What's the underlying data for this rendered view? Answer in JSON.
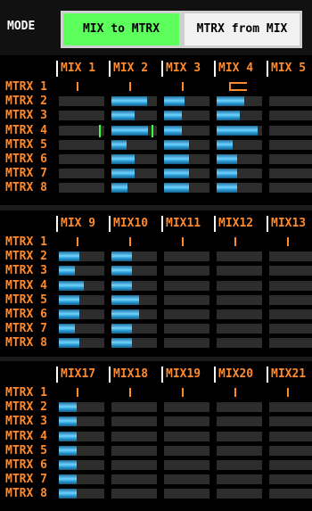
{
  "header": {
    "mode_label": "MODE",
    "mix_to_matrix_label": "MIX to MTRX",
    "matrix_from_mix_label": "MTRX from MIX",
    "active_mode": "MIX to MTRX"
  },
  "colors": {
    "accent_orange": "#ff8a2c",
    "active_green": "#5cff5c",
    "level_blue": "#4ab8ea"
  },
  "sections": [
    {
      "columns": [
        "MIX 1",
        "MIX 2",
        "MIX 3",
        "MIX 4",
        "MIX 5"
      ],
      "rows": [
        "MTRX 1",
        "MTRX 2",
        "MTRX 3",
        "MTRX 4",
        "MTRX 5",
        "MTRX 6",
        "MTRX 7",
        "MTRX 8"
      ],
      "levels": [
        [
          -1,
          -1,
          -1,
          -1,
          -1
        ],
        [
          0,
          0.78,
          0.45,
          0.6,
          0
        ],
        [
          0,
          0.5,
          0.4,
          0.5,
          0
        ],
        [
          0,
          0.8,
          0.4,
          0.9,
          0
        ],
        [
          0,
          0.33,
          0.55,
          0.35,
          0
        ],
        [
          0,
          0.5,
          0.55,
          0.45,
          0
        ],
        [
          0,
          0.5,
          0.55,
          0.45,
          0
        ],
        [
          0,
          0.35,
          0.55,
          0.45,
          0
        ]
      ],
      "markers": [
        {
          "row": 0,
          "col": 0,
          "type": "tick"
        },
        {
          "row": 0,
          "col": 1,
          "type": "tick"
        },
        {
          "row": 0,
          "col": 2,
          "type": "tick"
        },
        {
          "row": 0,
          "col": 3,
          "type": "bracket"
        },
        {
          "row": 3,
          "col": 0,
          "type": "green"
        },
        {
          "row": 3,
          "col": 1,
          "type": "green"
        }
      ]
    },
    {
      "columns": [
        "MIX 9",
        "MIX10",
        "MIX11",
        "MIX12",
        "MIX13"
      ],
      "rows": [
        "MTRX 1",
        "MTRX 2",
        "MTRX 3",
        "MTRX 4",
        "MTRX 5",
        "MTRX 6",
        "MTRX 7",
        "MTRX 8"
      ],
      "levels": [
        [
          -1,
          -1,
          -1,
          -1,
          -1
        ],
        [
          0.45,
          0.45,
          0,
          0,
          0
        ],
        [
          0.35,
          0.45,
          0,
          0,
          0
        ],
        [
          0.55,
          0.45,
          0,
          0,
          0
        ],
        [
          0.45,
          0.6,
          0,
          0,
          0
        ],
        [
          0.45,
          0.6,
          0,
          0,
          0
        ],
        [
          0.35,
          0.45,
          0,
          0,
          0
        ],
        [
          0.45,
          0.45,
          0,
          0,
          0
        ]
      ],
      "markers": [
        {
          "row": 0,
          "col": 0,
          "type": "tick"
        },
        {
          "row": 0,
          "col": 1,
          "type": "tick"
        },
        {
          "row": 0,
          "col": 2,
          "type": "tick"
        },
        {
          "row": 0,
          "col": 3,
          "type": "tick"
        },
        {
          "row": 0,
          "col": 4,
          "type": "tick"
        }
      ]
    },
    {
      "columns": [
        "MIX17",
        "MIX18",
        "MIX19",
        "MIX20",
        "MIX21"
      ],
      "rows": [
        "MTRX 1",
        "MTRX 2",
        "MTRX 3",
        "MTRX 4",
        "MTRX 5",
        "MTRX 6",
        "MTRX 7",
        "MTRX 8"
      ],
      "levels": [
        [
          -1,
          -1,
          -1,
          -1,
          -1
        ],
        [
          0.4,
          0,
          0,
          0,
          0
        ],
        [
          0.4,
          0,
          0,
          0,
          0
        ],
        [
          0.4,
          0,
          0,
          0,
          0
        ],
        [
          0.4,
          0,
          0,
          0,
          0
        ],
        [
          0.4,
          0,
          0,
          0,
          0
        ],
        [
          0.4,
          0,
          0,
          0,
          0
        ],
        [
          0.4,
          0,
          0,
          0,
          0
        ]
      ],
      "markers": [
        {
          "row": 0,
          "col": 0,
          "type": "tick"
        },
        {
          "row": 0,
          "col": 1,
          "type": "tick"
        },
        {
          "row": 0,
          "col": 2,
          "type": "tick"
        },
        {
          "row": 0,
          "col": 3,
          "type": "tick"
        },
        {
          "row": 0,
          "col": 4,
          "type": "tick"
        }
      ]
    }
  ]
}
